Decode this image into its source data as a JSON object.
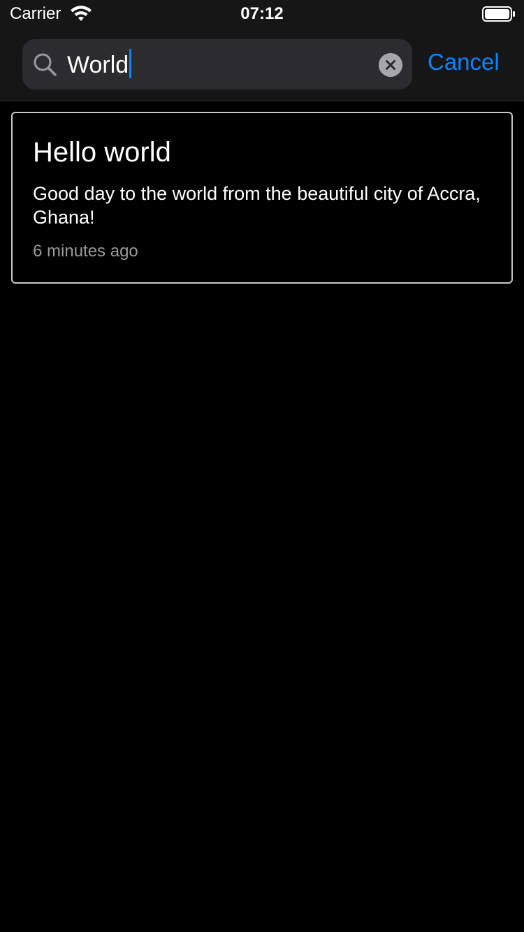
{
  "status_bar": {
    "carrier": "Carrier",
    "time": "07:12"
  },
  "search": {
    "query": "World",
    "cancel_label": "Cancel"
  },
  "results": [
    {
      "title": "Hello world",
      "body": "Good day to the world from the beautiful city of Accra, Ghana!",
      "timestamp": "6 minutes ago"
    }
  ],
  "colors": {
    "accent": "#0a84ff",
    "background": "#000000",
    "header": "#161616",
    "search_field": "#2c2c2e",
    "card_border": "#c8c8c8",
    "secondary_text": "#9a9a9a"
  }
}
